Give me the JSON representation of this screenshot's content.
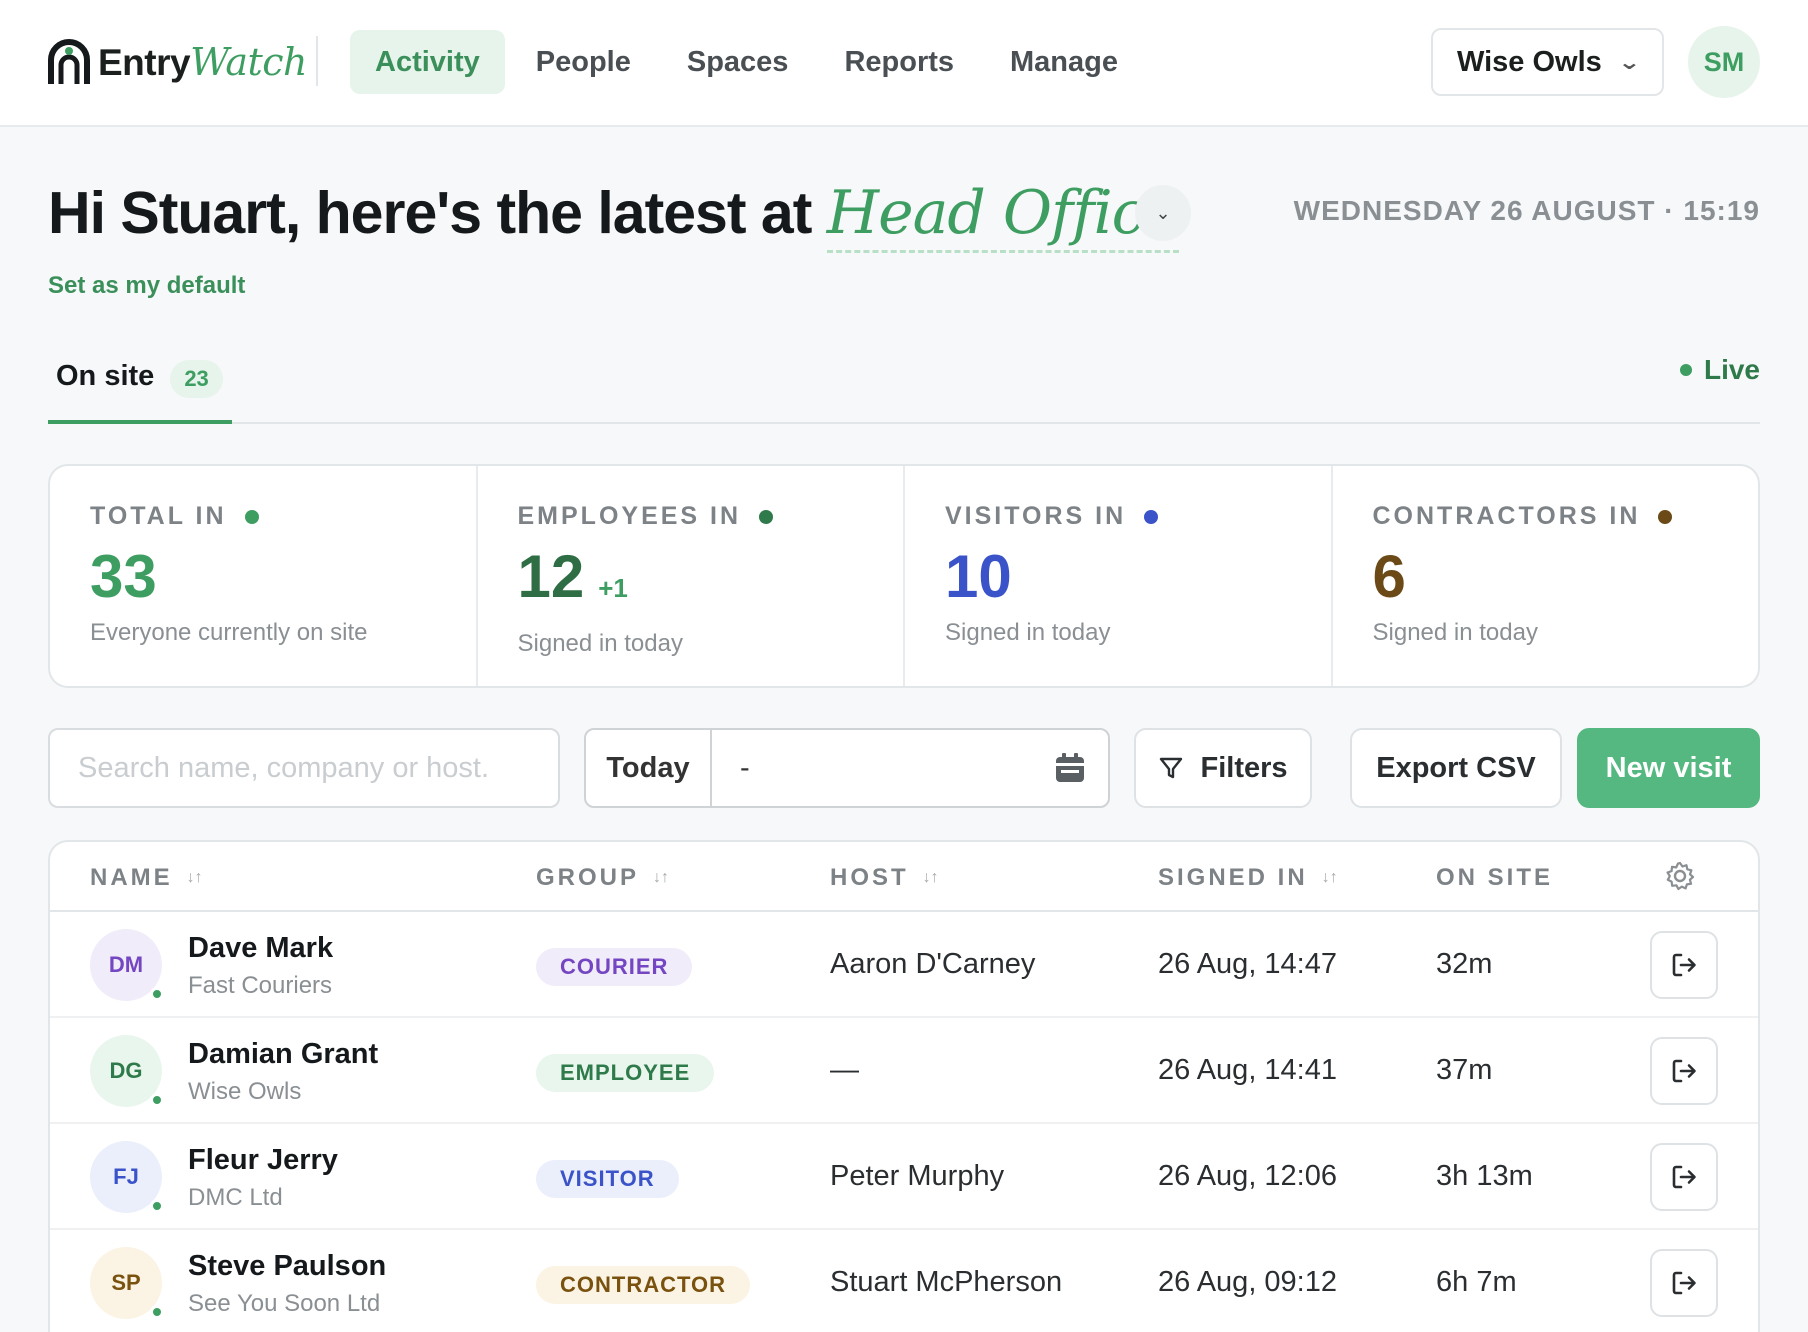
{
  "brand": {
    "name_a": "Entry",
    "name_b": "Watch"
  },
  "nav": {
    "items": [
      {
        "label": "Activity",
        "active": true
      },
      {
        "label": "People",
        "active": false
      },
      {
        "label": "Spaces",
        "active": false
      },
      {
        "label": "Reports",
        "active": false
      },
      {
        "label": "Manage",
        "active": false
      }
    ],
    "org": "Wise Owls",
    "user_initials": "SM"
  },
  "header": {
    "greeting": "Hi Stuart, here's the latest at",
    "location": "Head Office",
    "datetime": "WEDNESDAY 26 AUGUST · 15:19",
    "set_default": "Set as my default"
  },
  "tabs": {
    "on_site_label": "On site",
    "on_site_count": "23",
    "live_label": "Live"
  },
  "stats": [
    {
      "label": "TOTAL IN",
      "value": "33",
      "delta": "",
      "sub": "Everyone currently on site",
      "color": "#3e9e62",
      "dot": "#3e9e62"
    },
    {
      "label": "EMPLOYEES IN",
      "value": "12",
      "delta": "+1",
      "sub": "Signed in today",
      "color": "#2f6e45",
      "dot": "#2f7a4a"
    },
    {
      "label": "VISITORS IN",
      "value": "10",
      "delta": "",
      "sub": "Signed in today",
      "color": "#3b53c9",
      "dot": "#3b53c9"
    },
    {
      "label": "CONTRACTORS IN",
      "value": "6",
      "delta": "",
      "sub": "Signed in today",
      "color": "#6b4a17",
      "dot": "#6b4a17"
    }
  ],
  "toolbar": {
    "search_placeholder": "Search name, company or host.",
    "date_preset": "Today",
    "date_value": "-",
    "filters": "Filters",
    "export": "Export CSV",
    "new_visit": "New visit"
  },
  "table": {
    "columns": [
      "NAME",
      "GROUP",
      "HOST",
      "SIGNED IN",
      "ON SITE"
    ],
    "rows": [
      {
        "initials": "DM",
        "name": "Dave Mark",
        "company": "Fast Couriers",
        "group": "COURIER",
        "host": "Aaron D'Carney",
        "signed_in": "26 Aug, 14:47",
        "on_site": "32m",
        "av_bg": "#f1ecfa",
        "av_fg": "#7446c2",
        "pill_bg": "#f1ecfa",
        "pill_fg": "#7446c2"
      },
      {
        "initials": "DG",
        "name": "Damian Grant",
        "company": "Wise Owls",
        "group": "EMPLOYEE",
        "host": "—",
        "signed_in": "26 Aug, 14:41",
        "on_site": "37m",
        "av_bg": "#e9f6ee",
        "av_fg": "#2f7a4a",
        "pill_bg": "#e9f6ee",
        "pill_fg": "#2f7a4a"
      },
      {
        "initials": "FJ",
        "name": "Fleur Jerry",
        "company": "DMC Ltd",
        "group": "VISITOR",
        "host": "Peter Murphy",
        "signed_in": "26 Aug, 12:06",
        "on_site": "3h 13m",
        "av_bg": "#ebeffb",
        "av_fg": "#3b53c9",
        "pill_bg": "#ebeffb",
        "pill_fg": "#3b53c9"
      },
      {
        "initials": "SP",
        "name": "Steve Paulson",
        "company": "See You Soon Ltd",
        "group": "CONTRACTOR",
        "host": "Stuart McPherson",
        "signed_in": "26 Aug, 09:12",
        "on_site": "6h 7m",
        "av_bg": "#fbf3e3",
        "av_fg": "#7a5210",
        "pill_bg": "#fbf3e3",
        "pill_fg": "#7a5210"
      }
    ]
  }
}
